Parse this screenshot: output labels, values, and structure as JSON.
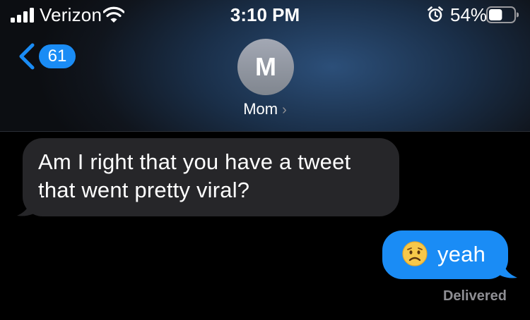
{
  "status_bar": {
    "carrier": "Verizon",
    "time": "3:10 PM",
    "battery_percent": "54%",
    "battery_level": 0.54,
    "signal_bars": 4,
    "icons": [
      "signal-icon",
      "wifi-icon",
      "alarm-icon",
      "battery-icon"
    ]
  },
  "header": {
    "back_count": "61",
    "avatar_initial": "M",
    "contact_name": "Mom",
    "accent_color": "#1a8cf5"
  },
  "messages": [
    {
      "direction": "incoming",
      "text": "Am I right that you have a tweet that went pretty viral?"
    },
    {
      "direction": "outgoing",
      "emoji": "worried-face-icon",
      "text": "yeah"
    }
  ],
  "delivery_status": "Delivered",
  "colors": {
    "incoming_bubble": "#262629",
    "outgoing_bubble": "#1a8cf5",
    "secondary_text": "#8e8e93"
  }
}
